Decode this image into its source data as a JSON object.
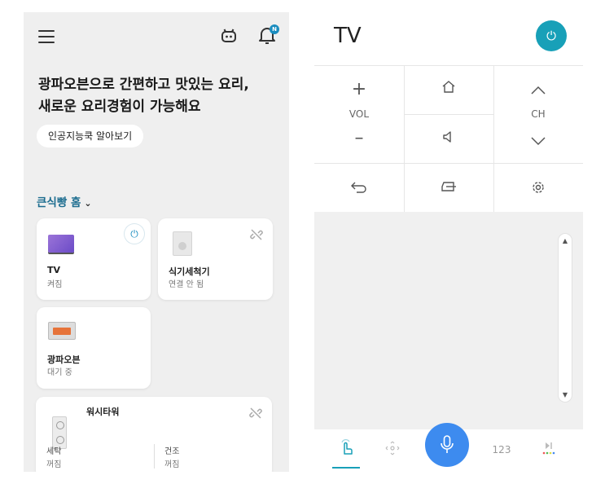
{
  "left": {
    "headline_line1": "광파오븐으로 간편하고 맛있는 요리,",
    "headline_line2": "새로운 요리경험이 가능해요",
    "ai_chip_label": "인공지능쿡 알아보기",
    "home_name": "큰식빵 홈",
    "notification_badge": "N",
    "devices": [
      {
        "name": "TV",
        "status": "켜짐"
      },
      {
        "name": "식기세척기",
        "status": "연결 안 됨"
      },
      {
        "name": "광파오븐",
        "status": "대기 중"
      }
    ],
    "washer": {
      "name": "워시타워",
      "wash_label": "세탁",
      "wash_status": "꺼짐",
      "dry_label": "건조",
      "dry_status": "꺼짐"
    }
  },
  "remote": {
    "title": "TV",
    "vol_label": "VOL",
    "ch_label": "CH",
    "numpad_tab": "123",
    "icons": [
      "power-icon",
      "plus-icon",
      "minus-icon",
      "home-icon",
      "mute-icon",
      "chevron-up-icon",
      "chevron-down-icon",
      "back-icon",
      "input-icon",
      "settings-icon",
      "touch-icon",
      "move-icon",
      "mic-icon",
      "media-icon"
    ],
    "accent_color": "#18a0b8",
    "mic_color": "#3d8bef"
  }
}
